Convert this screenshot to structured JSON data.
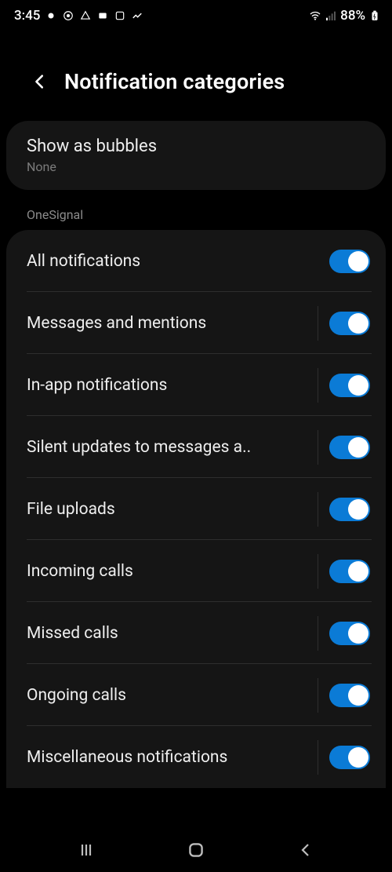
{
  "status": {
    "time": "3:45",
    "battery": "88%"
  },
  "header": {
    "title": "Notification categories"
  },
  "bubbles": {
    "title": "Show as bubbles",
    "value": "None"
  },
  "section": {
    "label": "OneSignal"
  },
  "items": [
    {
      "label": "All notifications",
      "on": true,
      "separator": false
    },
    {
      "label": "Messages and mentions",
      "on": true,
      "separator": true
    },
    {
      "label": "In-app notifications",
      "on": true,
      "separator": true
    },
    {
      "label": "Silent updates to messages a..",
      "on": true,
      "separator": true
    },
    {
      "label": "File uploads",
      "on": true,
      "separator": true
    },
    {
      "label": "Incoming calls",
      "on": true,
      "separator": true
    },
    {
      "label": "Missed calls",
      "on": true,
      "separator": true
    },
    {
      "label": "Ongoing calls",
      "on": true,
      "separator": true
    },
    {
      "label": "Miscellaneous notifications",
      "on": true,
      "separator": true
    }
  ]
}
